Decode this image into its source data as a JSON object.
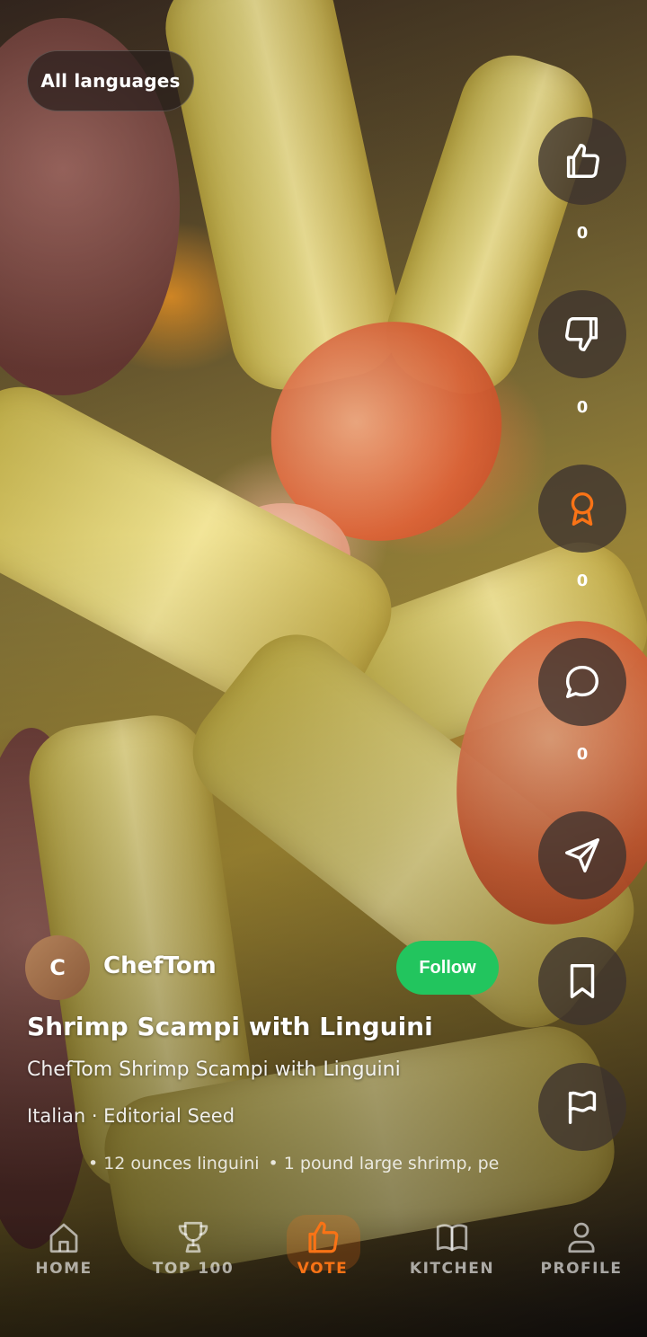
{
  "top": {
    "language_filter": "All languages"
  },
  "actions": [
    {
      "name": "like",
      "count": "0"
    },
    {
      "name": "dislike",
      "count": "0"
    },
    {
      "name": "award",
      "count": "0"
    },
    {
      "name": "comment",
      "count": "0"
    },
    {
      "name": "share"
    },
    {
      "name": "bookmark"
    },
    {
      "name": "report"
    }
  ],
  "post": {
    "author_initial": "C",
    "author": "ChefTom",
    "follow_label": "Follow",
    "title": "Shrimp Scampi with Linguini",
    "subtitle": "ChefTom Shrimp Scampi with Linguini",
    "meta": "Italian · Editorial Seed",
    "ingredients": [
      "12 ounces linguini",
      "1 pound large shrimp, pe"
    ]
  },
  "nav": {
    "items": [
      {
        "label": "HOME",
        "icon": "home-icon"
      },
      {
        "label": "TOP 100",
        "icon": "trophy-icon"
      },
      {
        "label": "VOTE",
        "icon": "thumbs-up-icon",
        "active": true
      },
      {
        "label": "KITCHEN",
        "icon": "book-icon"
      },
      {
        "label": "PROFILE",
        "icon": "user-icon"
      }
    ]
  },
  "colors": {
    "accent": "#f97316",
    "follow": "#22c55e"
  }
}
